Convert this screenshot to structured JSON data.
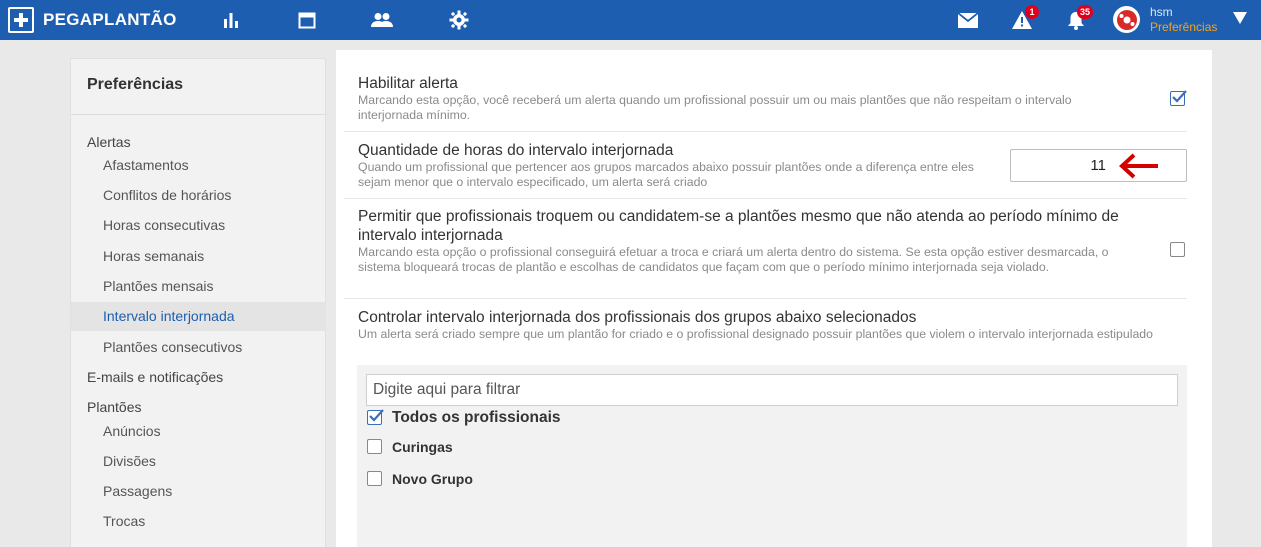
{
  "topbar": {
    "brand": "PEGAPLANTÃO",
    "alerts_badge": "1",
    "notifications_badge": "35",
    "user_name": "hsm",
    "user_sub": "Preferências"
  },
  "sidebar": {
    "title": "Preferências",
    "items": [
      {
        "label": "Alertas"
      },
      {
        "label": "Afastamentos"
      },
      {
        "label": "Conflitos de horários"
      },
      {
        "label": "Horas consecutivas"
      },
      {
        "label": "Horas semanais"
      },
      {
        "label": "Plantões mensais"
      },
      {
        "label": "Intervalo interjornada"
      },
      {
        "label": "Plantões consecutivos"
      },
      {
        "label": "E-mails e notificações"
      },
      {
        "label": "Plantões"
      },
      {
        "label": "Anúncios"
      },
      {
        "label": "Divisões"
      },
      {
        "label": "Passagens"
      },
      {
        "label": "Trocas"
      }
    ]
  },
  "settings": {
    "enable_alert": {
      "title": "Habilitar alerta",
      "desc": "Marcando esta opção, você receberá um alerta quando um profissional possuir um ou mais plantões que não respeitam o intervalo interjornada mínimo.",
      "checked": true
    },
    "hours": {
      "title": "Quantidade de horas do intervalo interjornada",
      "desc": "Quando um profissional que pertencer aos grupos marcados abaixo possuir plantões onde a diferença entre eles sejam menor que o intervalo especificado, um alerta será criado",
      "value": "11"
    },
    "allow_swap": {
      "title": "Permitir que profissionais troquem ou candidatem-se a plantões mesmo que não atenda ao período mínimo de intervalo interjornada",
      "desc": "Marcando esta opção o profissional conseguirá efetuar a troca e criará um alerta dentro do sistema. Se esta opção estiver desmarcada, o sistema bloqueará trocas de plantão e escolhas de candidatos que façam com que o período mínimo interjornada seja violado.",
      "checked": false
    },
    "control_groups": {
      "title": "Controlar intervalo interjornada dos profissionais dos grupos abaixo selecionados",
      "desc": "Um alerta será criado sempre que um plantão for criado e o profissional designado possuir plantões que violem o intervalo interjornada estipulado",
      "filter_placeholder": "Digite aqui para filtrar",
      "options": [
        {
          "label": "Todos os profissionais",
          "checked": true
        },
        {
          "label": "Curingas",
          "checked": false
        },
        {
          "label": "Novo Grupo",
          "checked": false
        }
      ]
    }
  },
  "colors": {
    "topbar": "#1d5eb1",
    "accent_orange": "#f6a31b",
    "badge_red": "#e0001b",
    "arrow_red": "#d40000"
  }
}
